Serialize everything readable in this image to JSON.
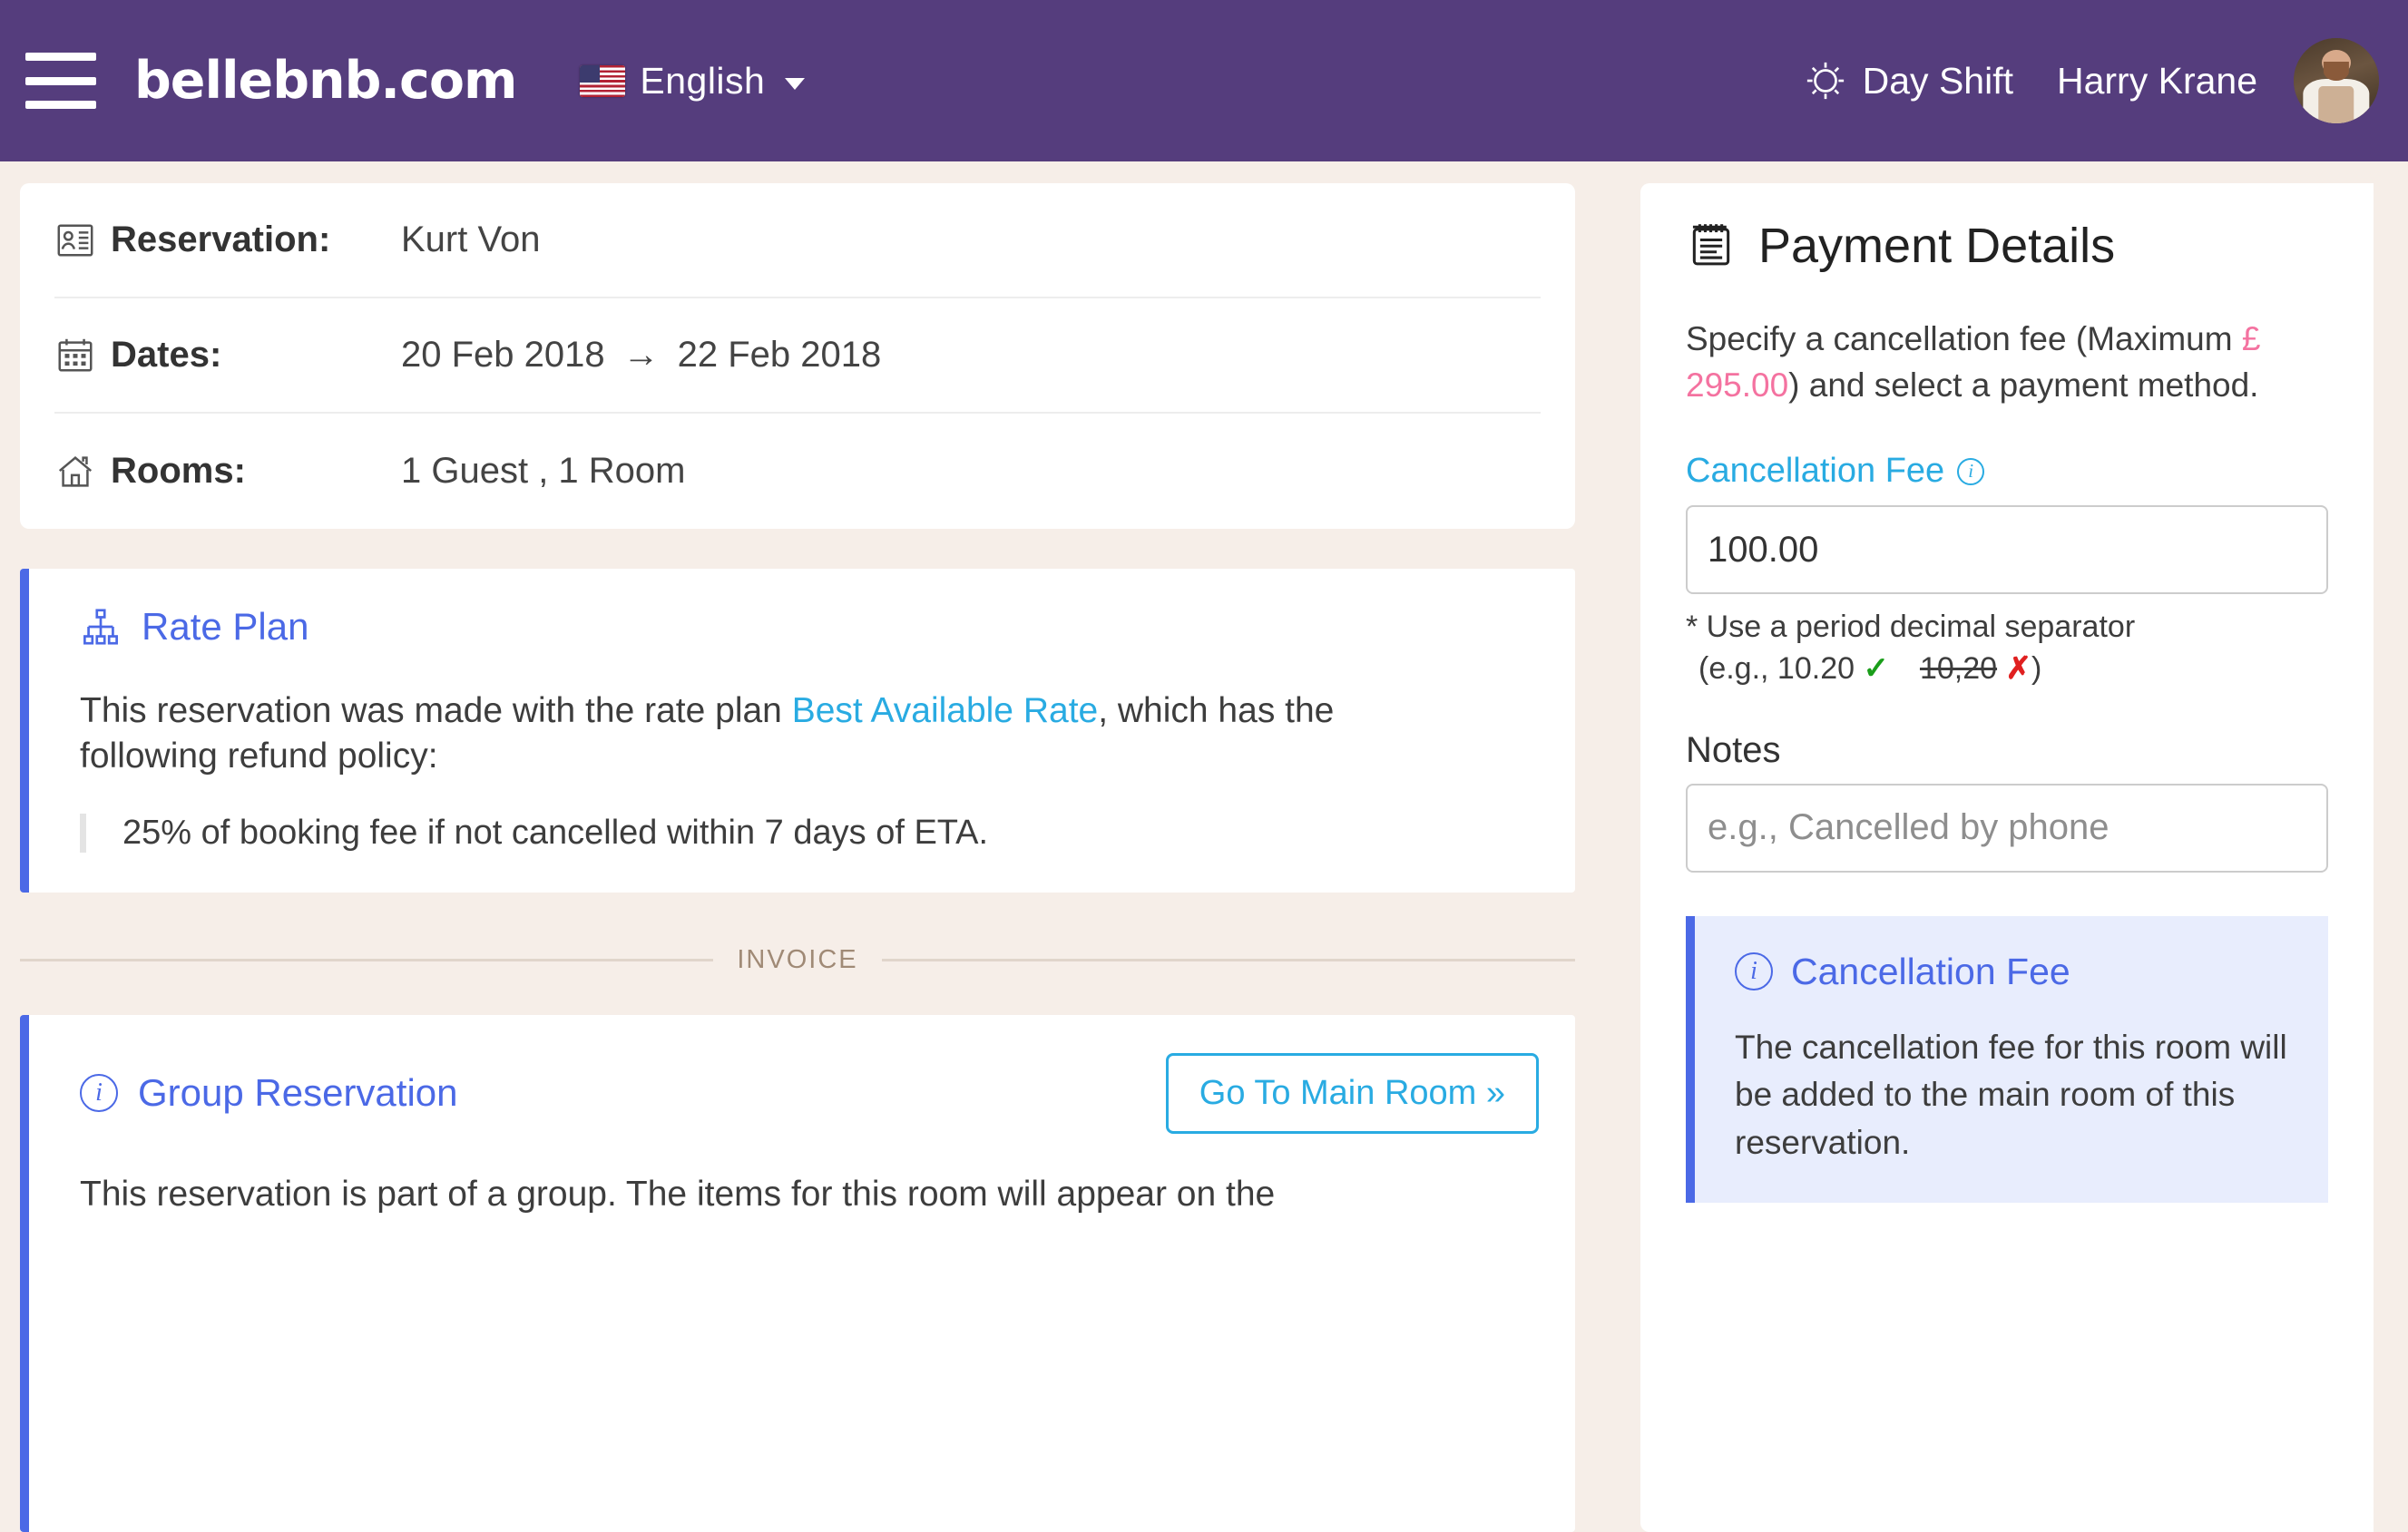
{
  "header": {
    "menu_icon": "hamburger-icon",
    "brand": "bellebnb.com",
    "language": "English",
    "language_flag": "us-flag-icon",
    "shift_icon": "sun-icon",
    "shift_label": "Day Shift",
    "user_name": "Harry Krane",
    "avatar_icon": "user-avatar"
  },
  "reservation": {
    "rows": [
      {
        "icon": "id-card-icon",
        "label": "Reservation:",
        "value": "Kurt Von"
      },
      {
        "icon": "calendar-icon",
        "label": "Dates:",
        "value_from": "20 Feb 2018",
        "arrow": "→",
        "value_to": "22 Feb 2018"
      },
      {
        "icon": "house-icon",
        "label": "Rooms:",
        "value": "1  Guest , 1 Room"
      }
    ]
  },
  "rate_plan": {
    "icon": "sitemap-icon",
    "title": "Rate Plan",
    "text_before": "This reservation was made with the rate plan ",
    "link": "Best Available Rate",
    "text_after": ", which has the following refund policy:",
    "policy": "25% of booking fee if not cancelled within 7 days of ETA."
  },
  "divider": {
    "label": "INVOICE"
  },
  "group": {
    "icon": "info-icon",
    "title": "Group Reservation",
    "button": "Go To Main Room »",
    "text": "This reservation is part of a group. The items for this room will appear on the"
  },
  "payment": {
    "icon": "notepad-icon",
    "title": "Payment Details",
    "desc_before": "Specify a cancellation fee (Maximum ",
    "max_amount": "£ 295.00",
    "desc_after": ") and select a payment method.",
    "fee_label": "Cancellation Fee",
    "fee_info_icon": "info-icon",
    "fee_value": "100.00",
    "hint_line1": "* Use a period decimal separator",
    "hint_eg_open": "(e.g., 10.20",
    "hint_ok": "✓",
    "hint_bad_value": "10,20",
    "hint_bad": "✗",
    "hint_close": ")",
    "notes_label": "Notes",
    "notes_placeholder": "e.g., Cancelled by phone",
    "infobox": {
      "icon": "info-icon",
      "title": "Cancellation Fee",
      "text": "The cancellation fee for this room will be added to the main room of this reservation."
    }
  },
  "colors": {
    "header_purple": "#553D7D",
    "page_background": "#F6EEE8",
    "accent_blue": "#4B69E6",
    "link_blue": "#29ABE2",
    "price_pink": "#F472A0",
    "divider_tan": "#a08a76"
  }
}
